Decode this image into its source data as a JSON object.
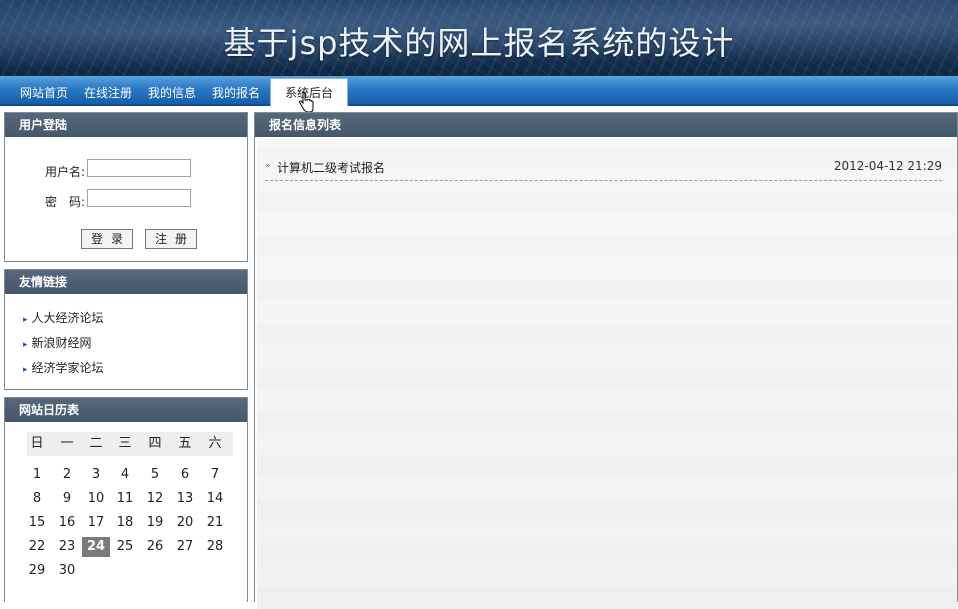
{
  "header": {
    "title": "基于jsp技术的网上报名系统的设计"
  },
  "nav": {
    "items": [
      {
        "label": "网站首页"
      },
      {
        "label": "在线注册"
      },
      {
        "label": "我的信息"
      },
      {
        "label": "我的报名"
      },
      {
        "label": "系统后台",
        "active": true
      }
    ]
  },
  "login": {
    "title": "用户登陆",
    "username_label": "用户名:",
    "password_label": "密　码:",
    "username_value": "",
    "password_value": "",
    "login_button": "登录",
    "register_button": "注册"
  },
  "links": {
    "title": "友情链接",
    "items": [
      "人大经济论坛",
      "新浪财经网",
      "经济学家论坛"
    ]
  },
  "calendar": {
    "title": "网站日历表",
    "weekdays": [
      "日",
      "一",
      "二",
      "三",
      "四",
      "五",
      "六"
    ],
    "today": 24,
    "rows": [
      [
        "1",
        "2",
        "3",
        "4",
        "5",
        "6",
        "7"
      ],
      [
        "8",
        "9",
        "10",
        "11",
        "12",
        "13",
        "14"
      ],
      [
        "15",
        "16",
        "17",
        "18",
        "19",
        "20",
        "21"
      ],
      [
        "22",
        "23",
        "24",
        "25",
        "26",
        "27",
        "28"
      ],
      [
        "29",
        "30",
        "",
        "",
        "",
        "",
        ""
      ]
    ]
  },
  "main": {
    "title": "报名信息列表",
    "items": [
      {
        "title": "计算机二级考试报名",
        "date": "2012-04-12 21:29"
      }
    ]
  },
  "icons": {
    "cursor": "hand-pointer-icon",
    "list_marker": "double-chevron-right-icon",
    "link_marker": "chevron-right-icon"
  },
  "colors": {
    "nav": "#2a78c4",
    "panel_head": "#4a5d70",
    "banner": "#163256"
  }
}
